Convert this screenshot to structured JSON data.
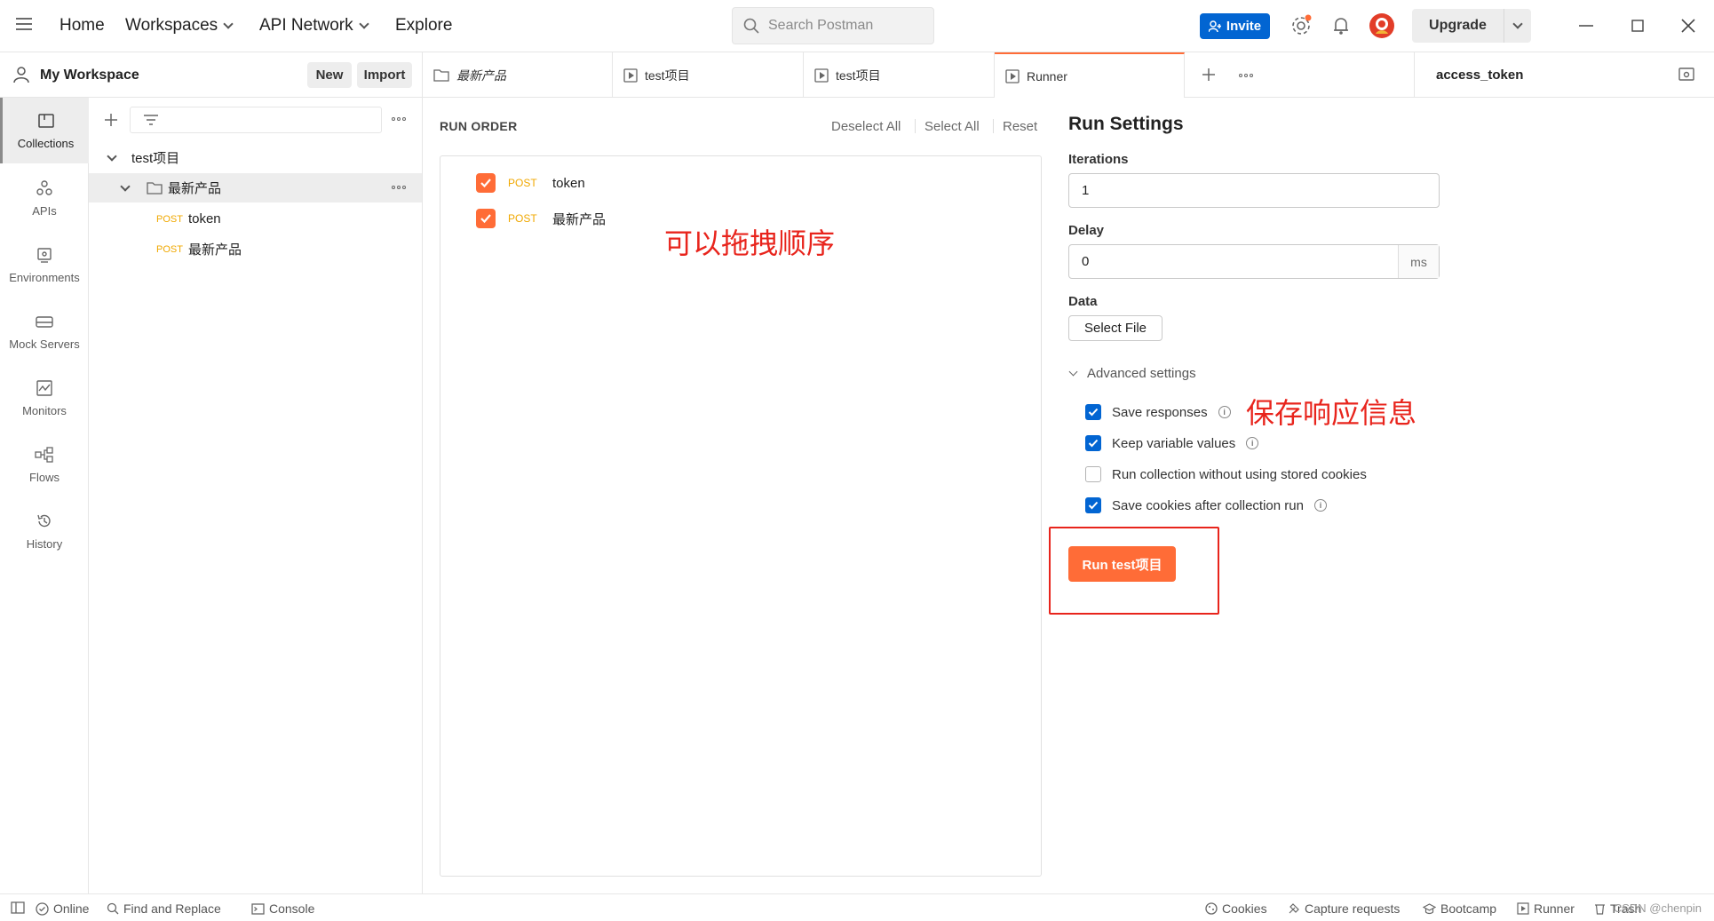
{
  "header": {
    "nav": [
      "Home",
      "Workspaces",
      "API Network",
      "Explore"
    ],
    "search_placeholder": "Search Postman",
    "invite_label": "Invite",
    "upgrade_label": "Upgrade"
  },
  "workspace": {
    "title": "My Workspace",
    "new_label": "New",
    "import_label": "Import"
  },
  "rail": [
    "Collections",
    "APIs",
    "Environments",
    "Mock Servers",
    "Monitors",
    "Flows",
    "History"
  ],
  "tree": {
    "collection": "test项目",
    "folder": "最新产品",
    "requests": [
      {
        "method": "POST",
        "name": "token"
      },
      {
        "method": "POST",
        "name": "最新产品"
      }
    ]
  },
  "tabs": [
    {
      "label": "最新产品"
    },
    {
      "label": "test项目"
    },
    {
      "label": "test项目"
    },
    {
      "label": "Runner"
    }
  ],
  "environment": "access_token",
  "run_order": {
    "title": "RUN ORDER",
    "deselect_all": "Deselect All",
    "select_all": "Select All",
    "reset": "Reset",
    "items": [
      {
        "method": "POST",
        "name": "token"
      },
      {
        "method": "POST",
        "name": "最新产品"
      }
    ],
    "annotation": "可以拖拽顺序"
  },
  "run_settings": {
    "title": "Run Settings",
    "iterations_label": "Iterations",
    "iterations_value": "1",
    "delay_label": "Delay",
    "delay_value": "0",
    "delay_unit": "ms",
    "data_label": "Data",
    "select_file_label": "Select File",
    "advanced_label": "Advanced settings",
    "options": [
      {
        "label": "Save responses",
        "checked": true
      },
      {
        "label": "Keep variable values",
        "checked": true
      },
      {
        "label": "Run collection without using stored cookies",
        "checked": false
      },
      {
        "label": "Save cookies after collection run",
        "checked": true
      }
    ],
    "annotation": "保存响应信息",
    "run_button": "Run test项目"
  },
  "status": {
    "online": "Online",
    "find_replace": "Find and Replace",
    "console": "Console",
    "cookies": "Cookies",
    "capture": "Capture requests",
    "bootcamp": "Bootcamp",
    "runner": "Runner",
    "trash": "Trash",
    "watermark": "CSDN @chenpin"
  },
  "colors": {
    "accent": "#ff6c37",
    "invite": "#0265d2",
    "annotation": "#e8241c",
    "post": "#f0a800"
  }
}
